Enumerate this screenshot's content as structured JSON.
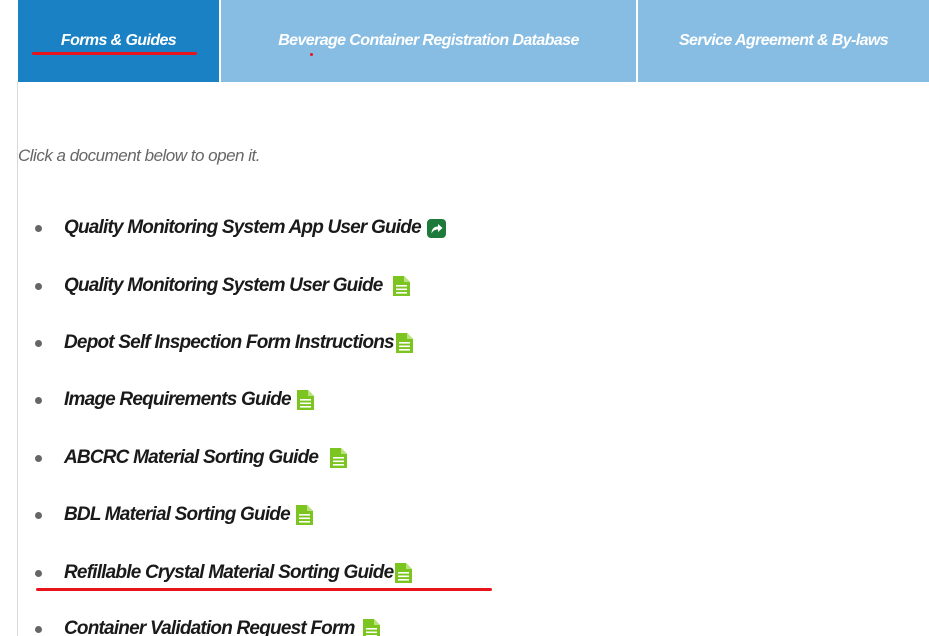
{
  "tabs": [
    {
      "label": "Forms & Guides",
      "active": true
    },
    {
      "label": "Beverage Container Registration Database",
      "active": false
    },
    {
      "label": "Service Agreement & By-laws",
      "active": false
    }
  ],
  "intro_text": "Click a document below to open it.",
  "documents": [
    {
      "label": "Quality Monitoring System App User Guide",
      "icon": "external-link-icon"
    },
    {
      "label": "Quality Monitoring System User Guide",
      "icon": "document-icon"
    },
    {
      "label": "Depot Self Inspection Form Instructions",
      "icon": "document-icon"
    },
    {
      "label": "Image Requirements Guide",
      "icon": "document-icon"
    },
    {
      "label": "ABCRC Material Sorting Guide",
      "icon": "document-icon"
    },
    {
      "label": "BDL Material Sorting Guide",
      "icon": "document-icon"
    },
    {
      "label": "Refillable Crystal Material Sorting Guide",
      "icon": "document-icon"
    },
    {
      "label": "Container Validation Request Form",
      "icon": "document-icon"
    }
  ],
  "colors": {
    "active_tab": "#1a82c4",
    "inactive_tab": "#87bde3",
    "icon_green": "#7cc521",
    "share_green": "#1d7a3a",
    "annotation_red": "#e8141b"
  }
}
